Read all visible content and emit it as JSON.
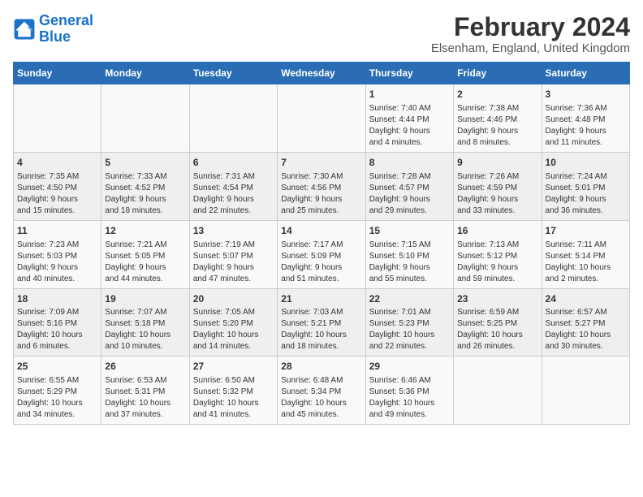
{
  "header": {
    "logo_line1": "General",
    "logo_line2": "Blue",
    "month_year": "February 2024",
    "location": "Elsenham, England, United Kingdom"
  },
  "days_of_week": [
    "Sunday",
    "Monday",
    "Tuesday",
    "Wednesday",
    "Thursday",
    "Friday",
    "Saturday"
  ],
  "weeks": [
    [
      {
        "day": "",
        "info": ""
      },
      {
        "day": "",
        "info": ""
      },
      {
        "day": "",
        "info": ""
      },
      {
        "day": "",
        "info": ""
      },
      {
        "day": "1",
        "info": "Sunrise: 7:40 AM\nSunset: 4:44 PM\nDaylight: 9 hours\nand 4 minutes."
      },
      {
        "day": "2",
        "info": "Sunrise: 7:38 AM\nSunset: 4:46 PM\nDaylight: 9 hours\nand 8 minutes."
      },
      {
        "day": "3",
        "info": "Sunrise: 7:36 AM\nSunset: 4:48 PM\nDaylight: 9 hours\nand 11 minutes."
      }
    ],
    [
      {
        "day": "4",
        "info": "Sunrise: 7:35 AM\nSunset: 4:50 PM\nDaylight: 9 hours\nand 15 minutes."
      },
      {
        "day": "5",
        "info": "Sunrise: 7:33 AM\nSunset: 4:52 PM\nDaylight: 9 hours\nand 18 minutes."
      },
      {
        "day": "6",
        "info": "Sunrise: 7:31 AM\nSunset: 4:54 PM\nDaylight: 9 hours\nand 22 minutes."
      },
      {
        "day": "7",
        "info": "Sunrise: 7:30 AM\nSunset: 4:56 PM\nDaylight: 9 hours\nand 25 minutes."
      },
      {
        "day": "8",
        "info": "Sunrise: 7:28 AM\nSunset: 4:57 PM\nDaylight: 9 hours\nand 29 minutes."
      },
      {
        "day": "9",
        "info": "Sunrise: 7:26 AM\nSunset: 4:59 PM\nDaylight: 9 hours\nand 33 minutes."
      },
      {
        "day": "10",
        "info": "Sunrise: 7:24 AM\nSunset: 5:01 PM\nDaylight: 9 hours\nand 36 minutes."
      }
    ],
    [
      {
        "day": "11",
        "info": "Sunrise: 7:23 AM\nSunset: 5:03 PM\nDaylight: 9 hours\nand 40 minutes."
      },
      {
        "day": "12",
        "info": "Sunrise: 7:21 AM\nSunset: 5:05 PM\nDaylight: 9 hours\nand 44 minutes."
      },
      {
        "day": "13",
        "info": "Sunrise: 7:19 AM\nSunset: 5:07 PM\nDaylight: 9 hours\nand 47 minutes."
      },
      {
        "day": "14",
        "info": "Sunrise: 7:17 AM\nSunset: 5:09 PM\nDaylight: 9 hours\nand 51 minutes."
      },
      {
        "day": "15",
        "info": "Sunrise: 7:15 AM\nSunset: 5:10 PM\nDaylight: 9 hours\nand 55 minutes."
      },
      {
        "day": "16",
        "info": "Sunrise: 7:13 AM\nSunset: 5:12 PM\nDaylight: 9 hours\nand 59 minutes."
      },
      {
        "day": "17",
        "info": "Sunrise: 7:11 AM\nSunset: 5:14 PM\nDaylight: 10 hours\nand 2 minutes."
      }
    ],
    [
      {
        "day": "18",
        "info": "Sunrise: 7:09 AM\nSunset: 5:16 PM\nDaylight: 10 hours\nand 6 minutes."
      },
      {
        "day": "19",
        "info": "Sunrise: 7:07 AM\nSunset: 5:18 PM\nDaylight: 10 hours\nand 10 minutes."
      },
      {
        "day": "20",
        "info": "Sunrise: 7:05 AM\nSunset: 5:20 PM\nDaylight: 10 hours\nand 14 minutes."
      },
      {
        "day": "21",
        "info": "Sunrise: 7:03 AM\nSunset: 5:21 PM\nDaylight: 10 hours\nand 18 minutes."
      },
      {
        "day": "22",
        "info": "Sunrise: 7:01 AM\nSunset: 5:23 PM\nDaylight: 10 hours\nand 22 minutes."
      },
      {
        "day": "23",
        "info": "Sunrise: 6:59 AM\nSunset: 5:25 PM\nDaylight: 10 hours\nand 26 minutes."
      },
      {
        "day": "24",
        "info": "Sunrise: 6:57 AM\nSunset: 5:27 PM\nDaylight: 10 hours\nand 30 minutes."
      }
    ],
    [
      {
        "day": "25",
        "info": "Sunrise: 6:55 AM\nSunset: 5:29 PM\nDaylight: 10 hours\nand 34 minutes."
      },
      {
        "day": "26",
        "info": "Sunrise: 6:53 AM\nSunset: 5:31 PM\nDaylight: 10 hours\nand 37 minutes."
      },
      {
        "day": "27",
        "info": "Sunrise: 6:50 AM\nSunset: 5:32 PM\nDaylight: 10 hours\nand 41 minutes."
      },
      {
        "day": "28",
        "info": "Sunrise: 6:48 AM\nSunset: 5:34 PM\nDaylight: 10 hours\nand 45 minutes."
      },
      {
        "day": "29",
        "info": "Sunrise: 6:46 AM\nSunset: 5:36 PM\nDaylight: 10 hours\nand 49 minutes."
      },
      {
        "day": "",
        "info": ""
      },
      {
        "day": "",
        "info": ""
      }
    ]
  ]
}
